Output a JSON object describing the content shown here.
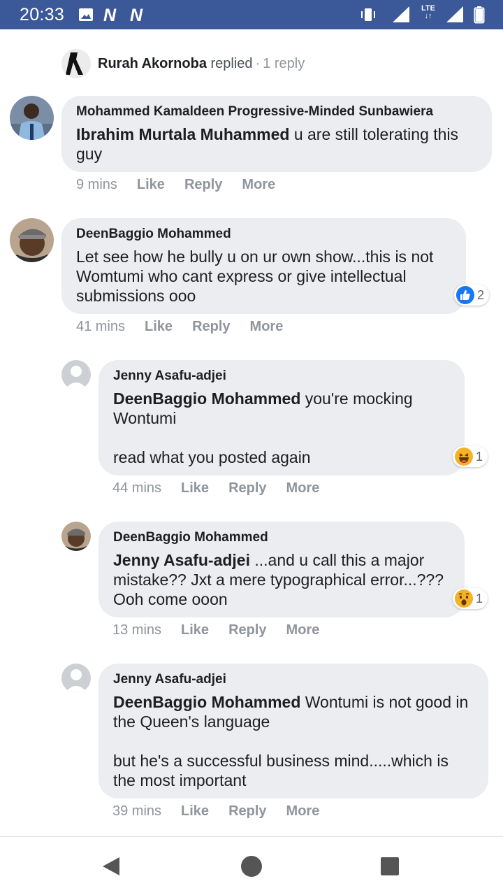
{
  "status_bar": {
    "time": "20:33",
    "left_icons": [
      "gallery-icon",
      "n-icon",
      "n-icon"
    ],
    "n_glyph": "N",
    "lte_label_top": "LTE",
    "lte_label_bottom": "↓↑",
    "right_icons": [
      "vibrate-icon",
      "signal-icon",
      "lte-icon",
      "signal-icon",
      "battery-icon"
    ],
    "background": "#3b5998"
  },
  "replied_row": {
    "name": "Rurah Akornoba",
    "verb": "replied",
    "separator": "·",
    "count": "1 reply"
  },
  "actions": {
    "like": "Like",
    "reply": "Reply",
    "more": "More"
  },
  "comments": [
    {
      "author": "Mohammed Kamaldeen Progressive-Minded Sunbawiera",
      "mention": "Ibrahim Murtala Muhammed",
      "text": " u are still tolerating this guy",
      "time": "9 mins"
    },
    {
      "author": "DeenBaggio Mohammed",
      "text": "Let see how he bully u on ur own show...this is not Womtumi who cant express or give intellectual submissions ooo",
      "time": "41 mins",
      "reaction": {
        "icon": "like-icon",
        "count": "2",
        "color": "#1877f2"
      }
    },
    {
      "author": "Jenny Asafu-adjei",
      "mention": "DeenBaggio Mohammed",
      "text": " you're mocking Wontumi",
      "text2": "read what you posted again",
      "time": "44 mins",
      "reaction": {
        "icon": "haha-icon",
        "count": "1",
        "color": "#f7b125"
      }
    },
    {
      "author": "DeenBaggio Mohammed",
      "mention": "Jenny Asafu-adjei",
      "text": " ...and u call this a major mistake?? Jxt a mere typographical error...??? Ooh come ooon",
      "time": "13 mins",
      "reaction": {
        "icon": "wow-icon",
        "count": "1",
        "color": "#f7b125"
      }
    },
    {
      "author": "Jenny Asafu-adjei",
      "mention": "DeenBaggio Mohammed",
      "text": " Wontumi is not good in the Queen's language",
      "text2": "but he's a successful business mind.....which is the most important",
      "time": "39 mins"
    }
  ],
  "nav_bar": {
    "icons": [
      "back-icon",
      "home-icon",
      "recents-icon"
    ]
  }
}
